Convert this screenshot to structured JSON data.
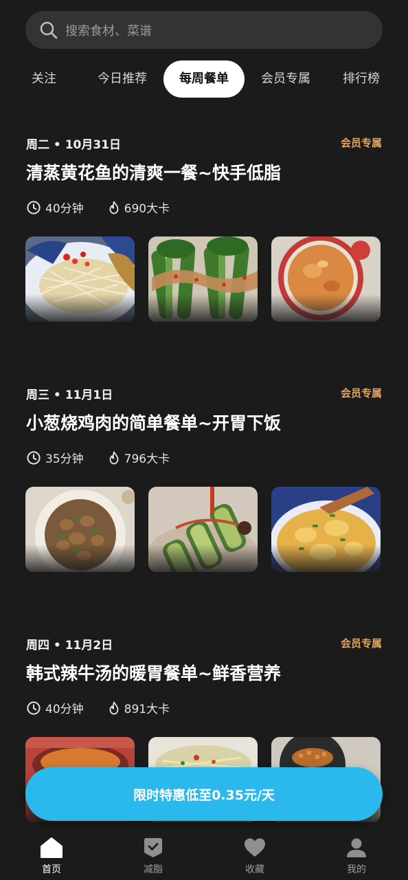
{
  "search": {
    "placeholder": "搜索食材、菜谱"
  },
  "tabs": [
    {
      "label": "关注"
    },
    {
      "label": "今日推荐"
    },
    {
      "label": "每周餐单",
      "active": true
    },
    {
      "label": "会员专属"
    },
    {
      "label": "排行榜"
    }
  ],
  "menus": [
    {
      "date": "周二 • 10月31日",
      "badge": "会员专属",
      "title": "清蒸黄花鱼的清爽一餐~快手低脂",
      "time": "40分钟",
      "calories": "690大卡",
      "images": [
        "steamed-fish",
        "choy-sum-garlic",
        "tomato-soup"
      ]
    },
    {
      "date": "周三 • 11月1日",
      "badge": "会员专属",
      "title": "小葱烧鸡肉的简单餐单~开胃下饭",
      "time": "35分钟",
      "calories": "796大卡",
      "images": [
        "scallion-chicken",
        "stuffed-cucumber",
        "scrambled-egg"
      ]
    },
    {
      "date": "周四 • 11月2日",
      "badge": "会员专属",
      "title": "韩式辣牛汤的暖胃餐单~鲜香营养",
      "time": "40分钟",
      "calories": "891大卡",
      "images": [
        "spicy-beef-soup",
        "shredded-potato",
        "minced-dish"
      ]
    }
  ],
  "promo": {
    "label": "限时特惠低至0.35元/天"
  },
  "nav": [
    {
      "label": "首页",
      "icon": "home-icon",
      "active": true
    },
    {
      "label": "减脂",
      "icon": "check-badge-icon"
    },
    {
      "label": "收藏",
      "icon": "heart-icon"
    },
    {
      "label": "我的",
      "icon": "user-icon"
    }
  ],
  "colors": {
    "background": "#1b1b1b",
    "accent": "#2bb8ec",
    "vip": "#e2a55f"
  }
}
